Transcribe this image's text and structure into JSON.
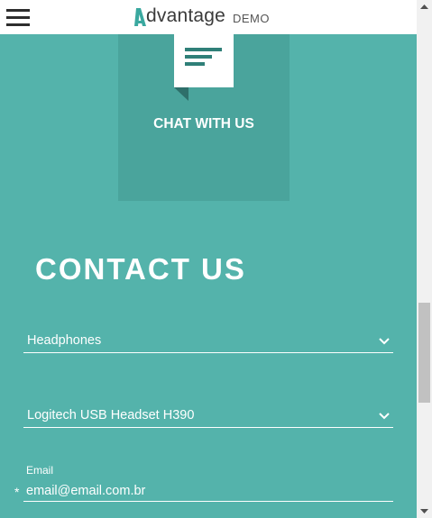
{
  "header": {
    "menu_icon": "hamburger-icon",
    "logo_word": "dvantage",
    "logo_suffix": "DEMO"
  },
  "chat": {
    "label": "CHAT WITH US",
    "icon": "chat-bubble-icon"
  },
  "contact": {
    "title": "CONTACT US",
    "category_select": {
      "value": "Headphones",
      "icon": "chevron-down-icon"
    },
    "product_select": {
      "value": "Logitech USB Headset H390",
      "icon": "chevron-down-icon"
    },
    "email": {
      "label": "Email",
      "required_mark": "*",
      "value": "email@email.com.br"
    }
  },
  "colors": {
    "background": "#54b3ab",
    "chat_box": "#4aa49c",
    "logo_accent": "#3aa89f",
    "header": "#ffffff"
  }
}
